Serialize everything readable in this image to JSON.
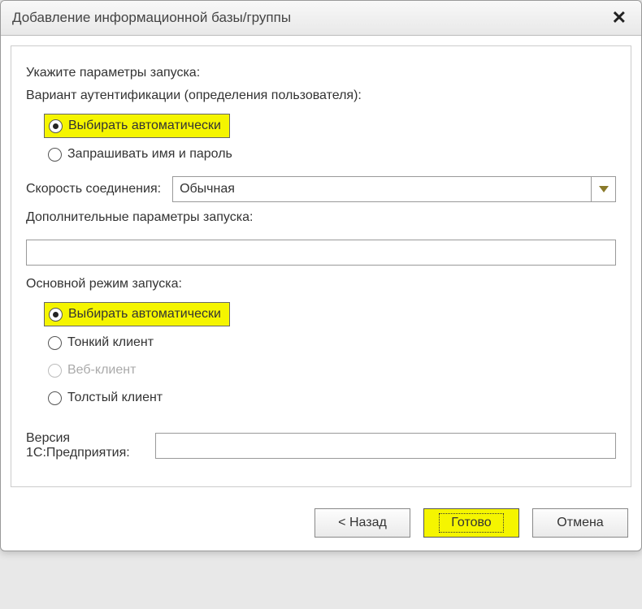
{
  "window": {
    "title": "Добавление информационной базы/группы"
  },
  "section": {
    "prompt": "Укажите параметры запуска:"
  },
  "auth": {
    "label": "Вариант аутентификации (определения пользователя):",
    "options": {
      "auto": "Выбирать автоматически",
      "ask": "Запрашивать имя и пароль"
    }
  },
  "speed": {
    "label": "Скорость соединения:",
    "value": "Обычная"
  },
  "extra": {
    "label": "Дополнительные параметры запуска:",
    "value": ""
  },
  "mode": {
    "label": "Основной режим запуска:",
    "options": {
      "auto": "Выбирать автоматически",
      "thin": "Тонкий клиент",
      "web": "Веб-клиент",
      "thick": "Толстый клиент"
    }
  },
  "version": {
    "label": "Версия 1С:Предприятия:",
    "value": ""
  },
  "buttons": {
    "back": "< Назад",
    "finish": "Готово",
    "cancel": "Отмена"
  }
}
